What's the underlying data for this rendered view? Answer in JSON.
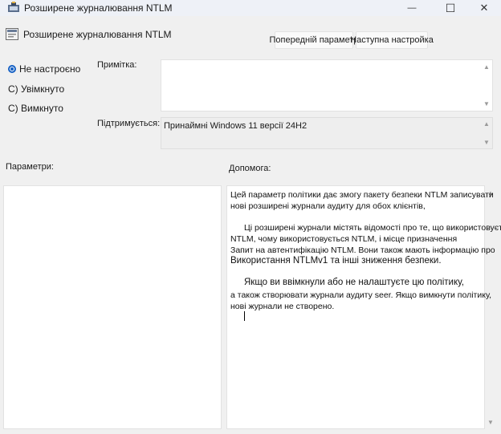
{
  "window": {
    "title": "Розширене журналювання NTLM",
    "minimize_glyph": "—",
    "maximize_glyph": "☐",
    "close_glyph": "✕"
  },
  "header": {
    "policy_name": "Розширене журналювання NTLM",
    "prev_button": "Попередній параметр",
    "next_button": "Наступна настройка"
  },
  "state": {
    "not_configured": "Не настроєно",
    "enabled": "С) Увімкнуто",
    "disabled": "С) Вимкнуто",
    "selected": "not_configured"
  },
  "comment": {
    "label": "Примітка:",
    "value": ""
  },
  "supported": {
    "label": "Підтримується:",
    "value": "Принаймні Windows 11 версії 24H2"
  },
  "options": {
    "label": "Параметри:"
  },
  "help": {
    "label": "Допомога:",
    "lines": [
      "Цей параметр політики дає змогу пакету безпеки NTLM записувати",
      "нові розширені журнали аудиту для обох клієнтів,",
      "Ці розширені журнали містять відомості про те, що використовується",
      "NTLM, чому використовується NTLM, і місце призначення",
      "Запит на автентифікацію NTLM. Вони також мають інформацію про",
      "Використання NTLMv1 та інші зниження безпеки.",
      "Якщо ви ввімкнули або не налаштуєте цю політику,",
      "а також створювати журнали аудиту seer. Якщо вимкнути політику,",
      "нові журнали не створено."
    ]
  },
  "colors": {
    "accent": "#1560c4",
    "background": "#f0f0f0",
    "titlebar": "#eef1f7"
  },
  "icons": {
    "app": "group-policy-icon",
    "policy": "policy-setting-icon",
    "scroll_up": "▲",
    "scroll_down": "▼"
  }
}
